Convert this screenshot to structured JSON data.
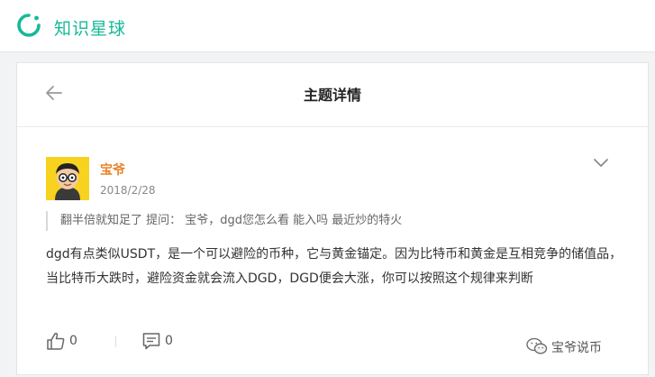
{
  "header": {
    "brand": "知识星球",
    "accent_color": "#16b998",
    "logo_icon": "planet-ring-logo"
  },
  "page": {
    "title": "主题详情",
    "back_icon": "arrow-left-icon"
  },
  "post": {
    "author": "宝爷",
    "date": "2018/2/28",
    "quote": "翻半倍就知足了 提问： 宝爷，dgd您怎么看 能入吗 最近炒的特火",
    "body": "dgd有点类似USDT，是一个可以避险的币种，它与黄金锚定。因为比特币和黄金是互相竞争的储值品，当比特币大跌时，避险资金就会流入DGD，DGD便会大涨，你可以按照这个规律来判断",
    "like_count": "0",
    "comment_count": "0",
    "author_color": "#e8832a"
  },
  "watermark": {
    "text": "宝爷说币",
    "icon": "wechat-icon"
  }
}
